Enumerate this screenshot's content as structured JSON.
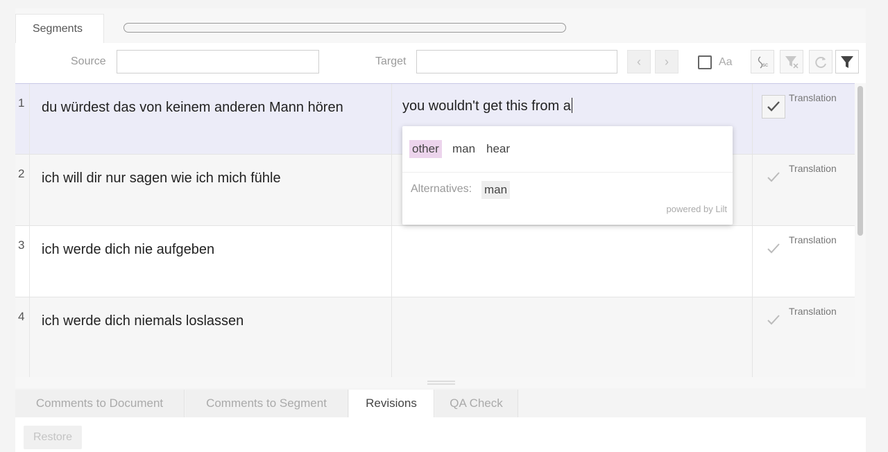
{
  "tabs": {
    "segments": "Segments"
  },
  "filter": {
    "source_label": "Source",
    "source_value": "",
    "target_label": "Target",
    "target_value": "",
    "prev_label": "‹",
    "next_label": "›",
    "case_label": "Aa"
  },
  "segments": [
    {
      "num": "1",
      "source": "du würdest das von keinem anderen Mann hören",
      "target": "you wouldn't get this from a",
      "status": "Translation"
    },
    {
      "num": "2",
      "source": "ich will dir nur sagen wie ich mich fühle",
      "target": "",
      "status": "Translation"
    },
    {
      "num": "3",
      "source": "ich werde dich nie aufgeben",
      "target": "",
      "status": "Translation"
    },
    {
      "num": "4",
      "source": "ich werde dich niemals loslassen",
      "target": "",
      "status": "Translation"
    }
  ],
  "popup": {
    "suggestions": [
      "other",
      "man",
      "hear"
    ],
    "alternatives_label": "Alternatives:",
    "alternatives": [
      "man"
    ],
    "powered_by": "powered by Lilt"
  },
  "bottom_tabs": [
    "Comments to Document",
    "Comments to Segment",
    "Revisions",
    "QA Check"
  ],
  "active_bottom_tab": "Revisions",
  "restore_label": "Restore",
  "colors": {
    "selected_row": "#ececf8",
    "highlight_suggestion": "#ecd4ec"
  }
}
